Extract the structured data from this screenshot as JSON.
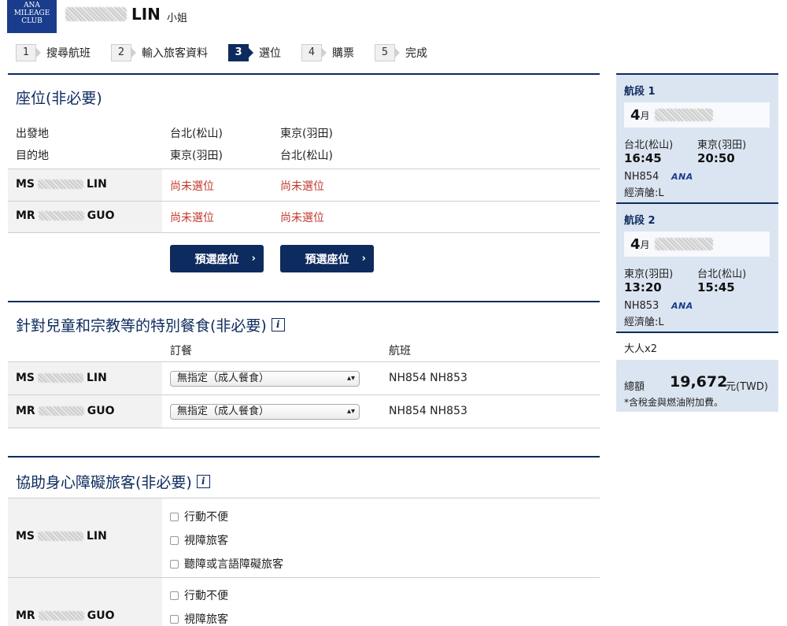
{
  "header": {
    "logo": [
      "ANA",
      "MILEAGE",
      "CLUB"
    ],
    "surname": "LIN",
    "salutation": "小姐"
  },
  "steps": [
    {
      "num": "1",
      "label": "搜尋航班",
      "active": false
    },
    {
      "num": "2",
      "label": "輸入旅客資料",
      "active": false
    },
    {
      "num": "3",
      "label": "選位",
      "active": true
    },
    {
      "num": "4",
      "label": "購票",
      "active": false
    },
    {
      "num": "5",
      "label": "完成",
      "active": false
    }
  ],
  "seats": {
    "title": "座位(非必要)",
    "origin_label": "出發地",
    "dest_label": "目的地",
    "seg1_origin": "台北(松山)",
    "seg1_dest": "東京(羽田)",
    "seg2_origin": "東京(羽田)",
    "seg2_dest": "台北(松山)",
    "passengers": [
      {
        "prefix": "MS",
        "surname": "LIN",
        "seg1": "尚未選位",
        "seg2": "尚未選位"
      },
      {
        "prefix": "MR",
        "surname": "GUO",
        "seg1": "尚未選位",
        "seg2": "尚未選位"
      }
    ],
    "select_button": "預選座位",
    "chevron": "›"
  },
  "meals": {
    "title": "針對兒童和宗教等的特別餐食(非必要)",
    "info": "i",
    "col_meal": "訂餐",
    "col_flight": "航班",
    "rows": [
      {
        "prefix": "MS",
        "surname": "LIN",
        "meal": "無指定（成人餐食）",
        "flights": "NH854 NH853"
      },
      {
        "prefix": "MR",
        "surname": "GUO",
        "meal": "無指定（成人餐食）",
        "flights": "NH854 NH853"
      }
    ],
    "select_arrow": "▴▾"
  },
  "assist": {
    "title": "協助身心障礙旅客(非必要)",
    "info": "i",
    "passengers": [
      {
        "prefix": "MS",
        "surname": "LIN",
        "options": [
          "行動不便",
          "視障旅客",
          "聽障或言語障礙旅客"
        ]
      },
      {
        "prefix": "MR",
        "surname": "GUO",
        "options": [
          "行動不便",
          "視障旅客"
        ]
      }
    ]
  },
  "sidebar": {
    "segments": [
      {
        "title": "航段 1",
        "month": "4",
        "month_unit": "月",
        "from": "台北(松山)",
        "to": "東京(羽田)",
        "dep": "16:45",
        "arr": "20:50",
        "flight": "NH854",
        "airline": "ANA",
        "cabin": "經濟艙:L"
      },
      {
        "title": "航段 2",
        "month": "4",
        "month_unit": "月",
        "from": "東京(羽田)",
        "to": "台北(松山)",
        "dep": "13:20",
        "arr": "15:45",
        "flight": "NH853",
        "airline": "ANA",
        "cabin": "經濟艙:L"
      }
    ],
    "pax_count": "大人x2",
    "total_label": "總額",
    "total_amount": "19,672",
    "total_unit": "元(TWD)",
    "note": "*含稅金與燃油附加費。"
  },
  "colors": {
    "navy": "#0d2b5e",
    "logo_blue": "#1a3c8c",
    "sidebar_bg": "#dbe5f1",
    "unselected_red": "#c0392b"
  }
}
